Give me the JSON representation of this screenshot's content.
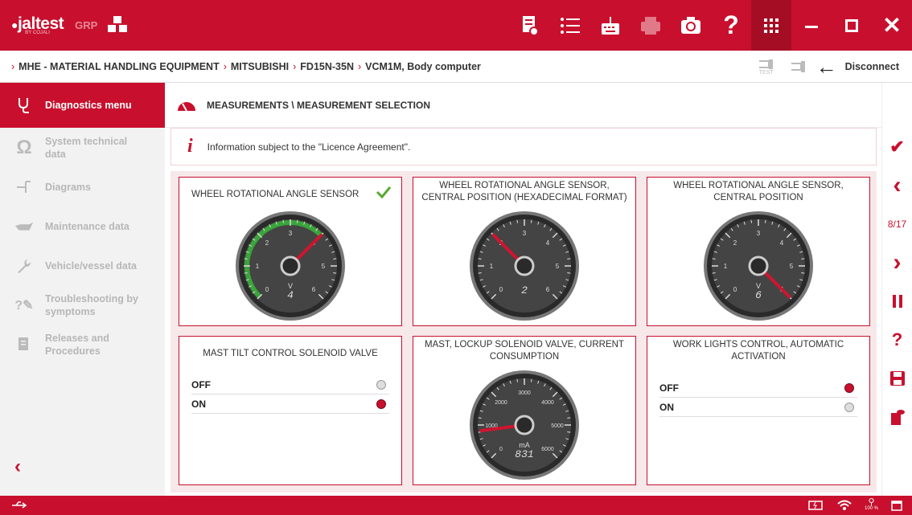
{
  "app": {
    "brand": "jaltest",
    "brand_sub": "BY COJALI",
    "grp": "GRP"
  },
  "breadcrumb": [
    "MHE - MATERIAL HANDLING EQUIPMENT",
    "MITSUBISHI",
    "FD15N-35N",
    "VCM1M, Body computer"
  ],
  "toolbar": {
    "disconnect": "Disconnect",
    "test_label": "TEST"
  },
  "sidebar": {
    "items": [
      {
        "label": "Diagnostics menu",
        "icon": "stethoscope-icon",
        "active": true
      },
      {
        "label": "System technical data",
        "icon": "omega-icon"
      },
      {
        "label": "Diagrams",
        "icon": "diagram-icon"
      },
      {
        "label": "Maintenance data",
        "icon": "oil-can-icon"
      },
      {
        "label": "Vehicle/vessel data",
        "icon": "wrench-icon"
      },
      {
        "label": "Troubleshooting by symptoms",
        "icon": "troubleshoot-icon"
      },
      {
        "label": "Releases and Procedures",
        "icon": "document-icon"
      }
    ]
  },
  "section_title": "MEASUREMENTS \\ MEASUREMENT SELECTION",
  "info_text": "Information subject to the \"Licence Agreement\".",
  "pagination": "8/17",
  "gauges": [
    {
      "title": "WHEEL ROTATIONAL ANGLE SENSOR",
      "unit": "V",
      "value": "4",
      "ticks": [
        "0",
        "1",
        "2",
        "3",
        "4",
        "5",
        "6"
      ],
      "min": 0,
      "max": 6,
      "needle": 4,
      "green": true,
      "checked": true
    },
    {
      "title": "WHEEL ROTATIONAL ANGLE SENSOR, CENTRAL POSITION (HEXADECIMAL FORMAT)",
      "unit": "",
      "value": "2",
      "ticks": [
        "0",
        "1",
        "2",
        "3",
        "4",
        "5",
        "6"
      ],
      "min": 0,
      "max": 6,
      "needle": 2,
      "green": false
    },
    {
      "title": "WHEEL ROTATIONAL ANGLE SENSOR, CENTRAL POSITION",
      "unit": "V",
      "value": "6",
      "ticks": [
        "0",
        "1",
        "2",
        "3",
        "4",
        "5",
        "6"
      ],
      "min": 0,
      "max": 6,
      "needle": 6,
      "green": false
    },
    {
      "title": "MAST, LOCKUP SOLENOID VALVE, CURRENT CONSUMPTION",
      "unit": "mA",
      "value": "831",
      "ticks": [
        "0",
        "1000",
        "2000",
        "3000",
        "4000",
        "5000",
        "6000"
      ],
      "min": 0,
      "max": 6000,
      "needle": 831,
      "green": false
    }
  ],
  "toggles": [
    {
      "title": "MAST TILT CONTROL SOLENOID VALVE",
      "rows": [
        {
          "label": "OFF",
          "on": false
        },
        {
          "label": "ON",
          "on": true
        }
      ]
    },
    {
      "title": "WORK LIGHTS CONTROL, AUTOMATIC ACTIVATION",
      "rows": [
        {
          "label": "OFF",
          "on": true
        },
        {
          "label": "ON",
          "on": false
        }
      ]
    }
  ],
  "status": {
    "zoom": "100 %"
  },
  "colors": {
    "brand": "#c8102e",
    "gauge_green": "#3aa53a"
  }
}
